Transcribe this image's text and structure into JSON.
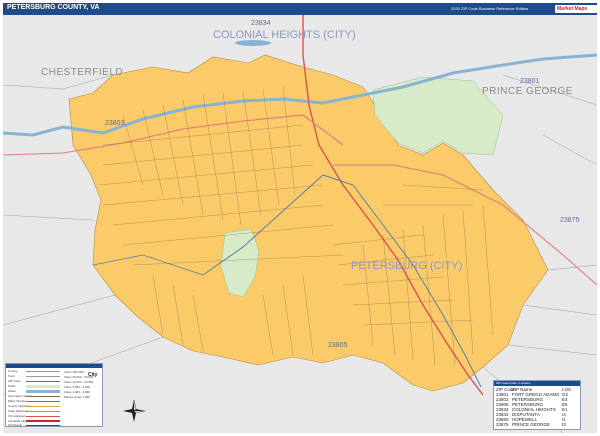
{
  "header": {
    "title": "PETERSBURG COUNTY, VA",
    "edition": "2020 ZIP Code Business Reference Edition",
    "brand": "Market Maps"
  },
  "map": {
    "county_labels": [
      "CHESTERFIELD",
      "PRINCE GEORGE"
    ],
    "city_labels": [
      "COLONIAL HEIGHTS (CITY)",
      "PETERSBURG (CITY)"
    ],
    "zip_labels": [
      "23834",
      "23803",
      "23801",
      "23875",
      "23805"
    ],
    "colors": {
      "background": "#e8e8e8",
      "zip_area": "#fbcb6a",
      "park": "#d7ebc9",
      "water": "#88b4d4",
      "highway": "#d9534f",
      "major_road": "#e27a7a",
      "street": "#8a6a4a",
      "rail": "#555555",
      "header": "#1e4b8c"
    }
  },
  "legend": {
    "rows": [
      "County",
      "Town",
      "ZIP Code",
      "Parks",
      "Water",
      "Secondary Streets",
      "Major Streets",
      "County Highways",
      "State Highways",
      "US Highways",
      "Interstate Highways",
      "Toll Roads"
    ],
    "right_labels": [
      "Cities 100,000+",
      "Cities 25,000 - 99,999",
      "Cities 10,000 - 24,999",
      "Cities 5,000 - 9,999",
      "Cities 1,000 - 4,999",
      "Places under 1,000"
    ],
    "city_sample": "City"
  },
  "zip_table": {
    "title": "ZIP Code Index / Location",
    "columns": [
      "ZIP Code",
      "ZIP Name",
      "LOC"
    ],
    "rows": [
      [
        "23801",
        "FORT GREGG ADAMS",
        "G2"
      ],
      [
        "23803",
        "PETERSBURG",
        "E4"
      ],
      [
        "23805",
        "PETERSBURG",
        "E5"
      ],
      [
        "23834",
        "COLONIAL HEIGHTS",
        "E1"
      ],
      [
        "23842",
        "DISPUTANTA",
        "I4"
      ],
      [
        "23860",
        "HOPEWELL",
        "I1"
      ],
      [
        "23875",
        "PRINCE GEORGE",
        "I3"
      ]
    ]
  }
}
